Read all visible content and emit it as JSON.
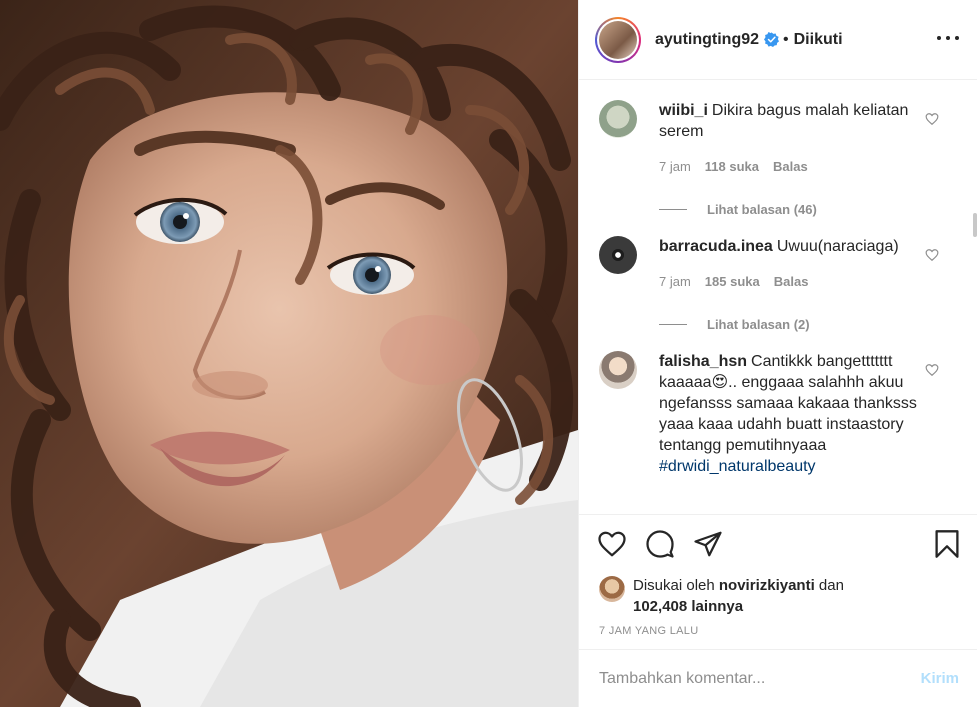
{
  "post": {
    "username": "ayutingting92",
    "separator": "•",
    "follow_status": "Diikuti"
  },
  "comments": [
    {
      "user": "wiibi_i",
      "text": "Dikira bagus malah keliatan serem",
      "time": "7 jam",
      "likes": "118 suka",
      "reply": "Balas",
      "replies": "Lihat balasan (46)"
    },
    {
      "user": "barracuda.inea",
      "text": "Uwuu(naraciaga)",
      "time": "7 jam",
      "likes": "185 suka",
      "reply": "Balas",
      "replies": "Lihat balasan (2)"
    },
    {
      "user": "falisha_hsn",
      "text": "Cantikkk bangettttttt kaaaaa😍.. enggaaa salahhh akuu ngefansss samaaa kakaaa thanksss yaaa kaaa udahh buatt instaastory tentangg pemutihnyaaa",
      "hashtag": "#drwidi_naturalbeauty"
    }
  ],
  "likes": {
    "prefix": "Disukai oleh",
    "user": "novirizkiyanti",
    "suffix": "dan",
    "others": "102,408 lainnya"
  },
  "time_ago": "7 JAM YANG LALU",
  "add_comment": {
    "placeholder": "Tambahkan komentar...",
    "send_label": "Kirim"
  },
  "colors": {
    "link_blue": "#00376b",
    "send_disabled": "#b2dffc",
    "verified_blue": "#3897f0",
    "muted": "#8e8e8e"
  },
  "icons": [
    "more-options-icon",
    "heart-icon",
    "comment-icon",
    "share-icon",
    "bookmark-icon",
    "verified-badge-icon"
  ]
}
